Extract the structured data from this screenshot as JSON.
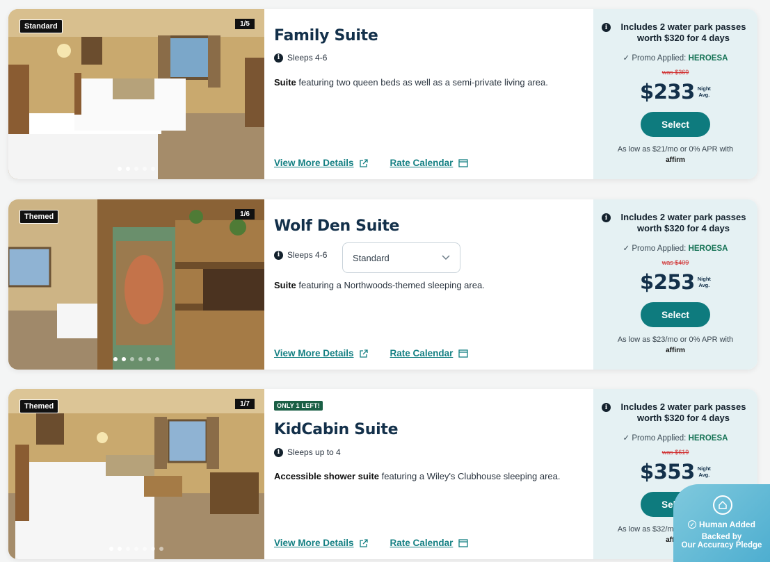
{
  "rooms": [
    {
      "photo_tag": "Standard",
      "photo_counter": "1/5",
      "badge": "",
      "title": "Family Suite",
      "sleeps": "Sleeps 4-6",
      "bed_select": "",
      "desc_bold": "Suite",
      "desc_rest": " featuring two queen beds as well as a semi-private living area.",
      "link_details": "View More Details",
      "link_calendar": "Rate Calendar",
      "perk": "Includes 2 water park passes worth $320 for 4 days",
      "promo_label": "Promo Applied: ",
      "promo_code": "HEROESA",
      "was_price": "was $369",
      "price": "$233",
      "night_label_1": "Night",
      "night_label_2": "Avg.",
      "select_label": "Select",
      "finance": "As low as $21/mo or 0% APR with",
      "affirm": "affirm",
      "dots_total": 5,
      "dots_active": 2
    },
    {
      "photo_tag": "Themed",
      "photo_counter": "1/6",
      "badge": "",
      "title": "Wolf Den Suite",
      "sleeps": "Sleeps 4-6",
      "bed_select": "Standard",
      "desc_bold": "Suite",
      "desc_rest": " featuring a Northwoods-themed sleeping area.",
      "link_details": "View More Details",
      "link_calendar": "Rate Calendar",
      "perk": "Includes 2 water park passes worth $320 for 4 days",
      "promo_label": "Promo Applied: ",
      "promo_code": "HEROESA",
      "was_price": "was $409",
      "price": "$253",
      "night_label_1": "Night",
      "night_label_2": "Avg.",
      "select_label": "Select",
      "finance": "As low as $23/mo or 0% APR with",
      "affirm": "affirm",
      "dots_total": 6,
      "dots_active": 2
    },
    {
      "photo_tag": "Themed",
      "photo_counter": "1/7",
      "badge": "ONLY 1 LEFT!",
      "title": "KidCabin Suite",
      "sleeps": "Sleeps up to 4",
      "bed_select": "",
      "desc_bold": "Accessible shower suite",
      "desc_rest": " featuring a Wiley's Clubhouse sleeping area.",
      "link_details": "View More Details",
      "link_calendar": "Rate Calendar",
      "perk": "Includes 2 water park passes worth $320 for 4 days",
      "promo_label": "Promo Applied: ",
      "promo_code": "HEROESA",
      "was_price": "was $619",
      "price": "$353",
      "night_label_1": "Night",
      "night_label_2": "Avg.",
      "select_label": "Select",
      "finance": "As low as $32/mo or 0% APR with",
      "affirm": "affirm",
      "dots_total": 7,
      "dots_active": 2
    }
  ],
  "overlay": {
    "line1": "Human Added",
    "line2a": "Backed by",
    "line2b": "Our Accuracy Pledge"
  },
  "colors": {
    "accent": "#0e7b7e",
    "price_panel": "#e5f1f3",
    "promo_code": "#167356",
    "strike": "#d02a2a"
  }
}
